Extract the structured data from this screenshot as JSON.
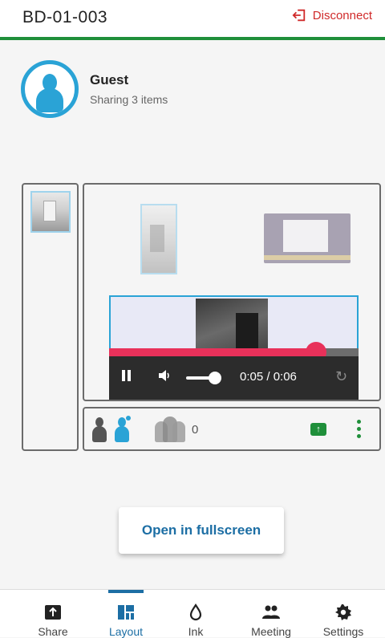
{
  "header": {
    "device_id": "BD-01-003",
    "disconnect_label": "Disconnect",
    "accent_color": "#1f8f3a",
    "danger_color": "#d02a2a"
  },
  "user": {
    "name": "Guest",
    "status": "Sharing 3 items"
  },
  "video": {
    "time": "0:05 / 0:06",
    "progress": 0.83,
    "volume": 0.8,
    "state": "playing"
  },
  "participants": {
    "count": "0"
  },
  "actions": {
    "fullscreen_label": "Open in fullscreen"
  },
  "tabs": [
    {
      "label": "Share",
      "icon": "share-upload-icon",
      "active": false
    },
    {
      "label": "Layout",
      "icon": "layout-icon",
      "active": true
    },
    {
      "label": "Ink",
      "icon": "ink-drop-icon",
      "active": false
    },
    {
      "label": "Meeting",
      "icon": "people-icon",
      "active": false
    },
    {
      "label": "Settings",
      "icon": "gear-icon",
      "active": false
    }
  ]
}
